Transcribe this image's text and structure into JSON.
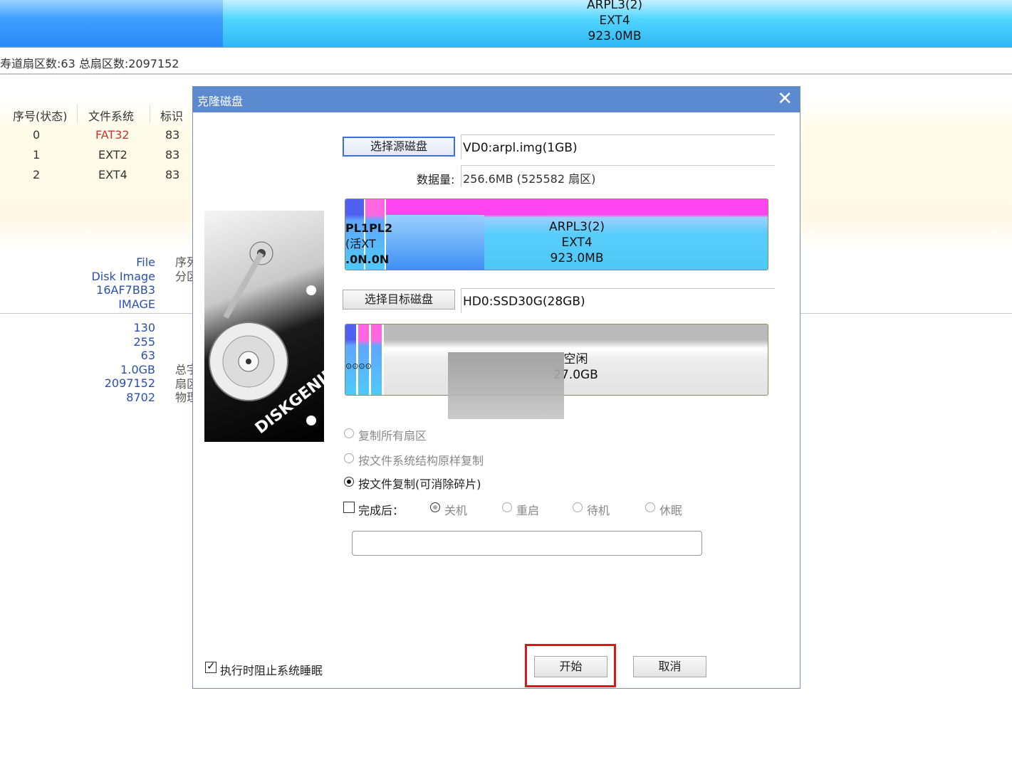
{
  "top_disk": {
    "name": "ARPL3(2)",
    "fs": "EXT4",
    "size": "923.0MB"
  },
  "info_line": "寿道扇区数:63   总扇区数:2097152",
  "partition_table": {
    "headers": [
      "序号(状态)",
      "文件系统",
      "标识"
    ],
    "rows": [
      {
        "index": "0",
        "fs": "FAT32",
        "id": "83"
      },
      {
        "index": "1",
        "fs": "EXT2",
        "id": "83"
      },
      {
        "index": "2",
        "fs": "EXT4",
        "id": "83"
      }
    ]
  },
  "disk_info": {
    "lines_a": [
      "File",
      "Disk Image",
      "16AF7BB3",
      "IMAGE"
    ],
    "side_a": [
      "序列",
      "分区"
    ],
    "lines_b": [
      "130",
      "255",
      "63",
      "1.0GB",
      "2097152",
      "8702"
    ],
    "side_b": [
      "总字",
      "扇区",
      "物理"
    ]
  },
  "dialog": {
    "title": "克隆磁盘",
    "close_icon": "close-icon",
    "select_source_label": "选择源磁盘",
    "source_value": "VD0:arpl.img(1GB)",
    "data_amount_label": "数据量:",
    "data_amount_value": "256.6MB (525582 扇区)",
    "source_disk": {
      "small_parts": [
        "PL1",
        "PL2"
      ],
      "small_lines": [
        "(活",
        "XT",
        ".0N",
        ".0N"
      ],
      "main_name": "ARPL3(2)",
      "main_fs": "EXT4",
      "main_size": "923.0MB"
    },
    "select_target_label": "选择目标磁盘",
    "target_value": "HD0:SSD30G(28GB)",
    "target_disk": {
      "free_label": "空闲",
      "free_size": "27.0GB"
    },
    "options": [
      {
        "label": "复制所有扇区",
        "checked": false,
        "enabled": false
      },
      {
        "label": "按文件系统结构原样复制",
        "checked": false,
        "enabled": false
      },
      {
        "label": "按文件复制(可消除碎片)",
        "checked": true,
        "enabled": true
      }
    ],
    "after_complete": {
      "label": "完成后：",
      "checked": false,
      "choices": [
        "关机",
        "重启",
        "待机",
        "休眠"
      ],
      "selected": "关机"
    },
    "progress_text": "",
    "prevent_sleep_label": "执行时阻止系统睡眠",
    "prevent_sleep_checked": true,
    "start_label": "开始",
    "cancel_label": "取消",
    "highlight_color": "#e0141e",
    "logo_text": "DISKGENIUS"
  }
}
